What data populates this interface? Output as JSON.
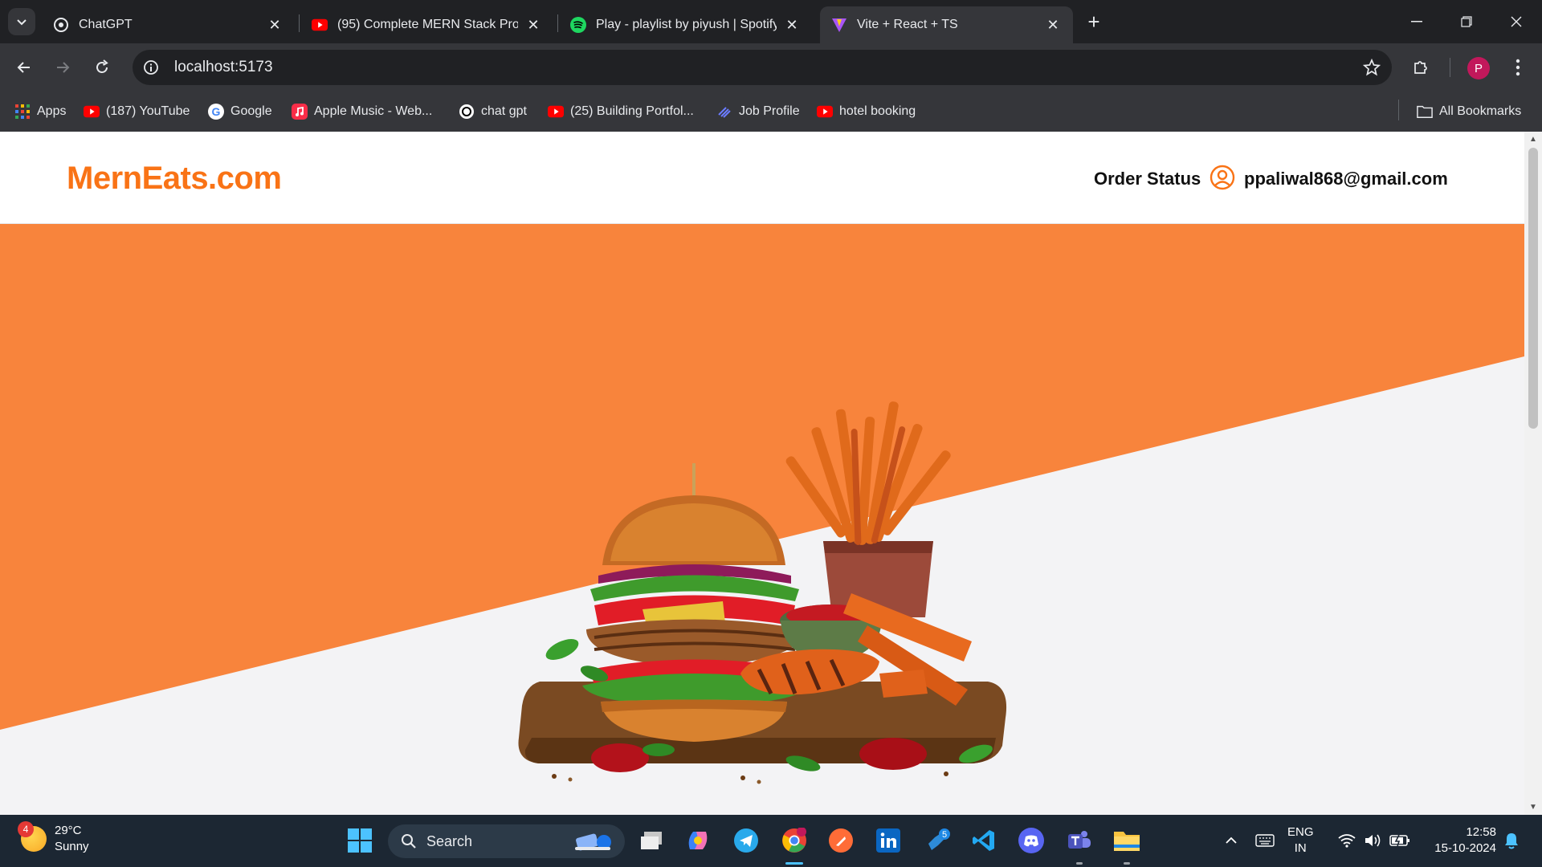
{
  "browser": {
    "tabs": [
      {
        "title": "ChatGPT",
        "favicon": "chatgpt-icon",
        "active": false
      },
      {
        "title": "(95) Complete MERN Stack Proj",
        "favicon": "youtube-icon",
        "active": false
      },
      {
        "title": "Play - playlist by piyush | Spotify",
        "favicon": "spotify-icon",
        "active": false
      },
      {
        "title": "Vite + React + TS",
        "favicon": "vite-icon",
        "active": true
      }
    ],
    "url": "localhost:5173",
    "profile_initial": "P",
    "bookmarks": [
      {
        "label": "Apps",
        "icon": "apps-grid-icon"
      },
      {
        "label": "(187) YouTube",
        "icon": "youtube-icon"
      },
      {
        "label": "Google",
        "icon": "google-icon"
      },
      {
        "label": "Apple Music - Web...",
        "icon": "apple-music-icon"
      },
      {
        "label": "chat gpt",
        "icon": "chatgpt-icon"
      },
      {
        "label": "(25) Building Portfol...",
        "icon": "youtube-icon"
      },
      {
        "label": "Job Profile",
        "icon": "link-icon"
      },
      {
        "label": "hotel booking",
        "icon": "youtube-icon"
      }
    ],
    "all_bookmarks": "All Bookmarks"
  },
  "site": {
    "logo": "MernEats.com",
    "nav": {
      "order_status": "Order Status",
      "user_email": "ppaliwal868@gmail.com"
    },
    "colors": {
      "brand": "#f97316",
      "hero_orange": "#f8843c",
      "hero_gray": "#f3f3f5"
    }
  },
  "taskbar": {
    "weather": {
      "temp": "29°C",
      "condition": "Sunny",
      "badge": "4"
    },
    "search_placeholder": "Search",
    "apps": [
      "windows-start-icon",
      "file-explorer-icon",
      "copilot-icon",
      "telegram-icon",
      "chrome-icon",
      "postman-icon",
      "linkedin-icon",
      "azure-devops-icon",
      "vscode-icon",
      "discord-icon",
      "teams-icon",
      "folder-icon"
    ],
    "lang": {
      "line1": "ENG",
      "line2": "IN"
    },
    "clock": {
      "time": "12:58",
      "date": "15-10-2024"
    }
  }
}
